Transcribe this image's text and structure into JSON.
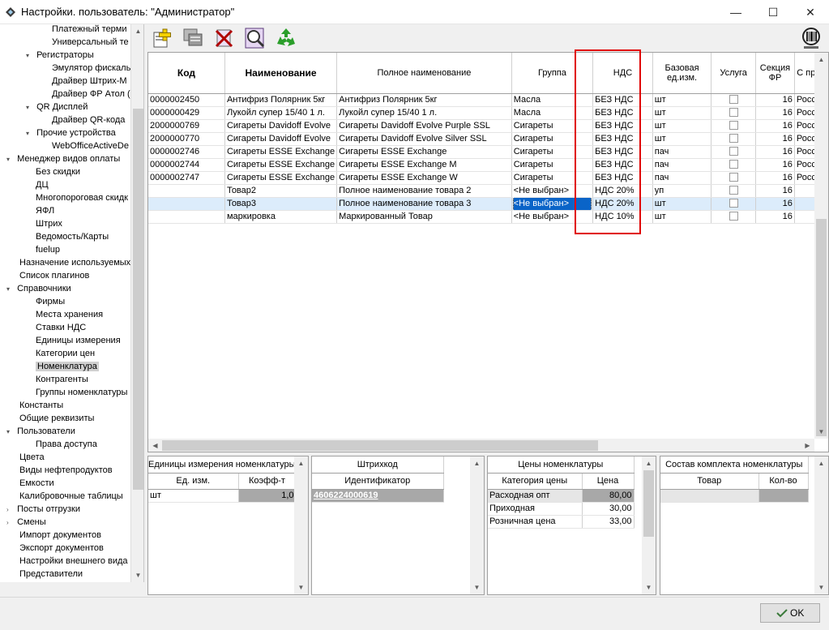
{
  "window": {
    "title": "Настройки. пользователь: \"Администратор\"",
    "minimize": "—",
    "maximize": "☐",
    "close": "✕"
  },
  "tree": {
    "items": [
      {
        "label": "Платежный терми",
        "level": 3,
        "expander": ""
      },
      {
        "label": "Универсальный те",
        "level": 3,
        "expander": ""
      },
      {
        "label": "Регистраторы",
        "level": 2,
        "expander": "▾"
      },
      {
        "label": "Эмулятор фискаль",
        "level": 3,
        "expander": ""
      },
      {
        "label": "Драйвер Штрих-М",
        "level": 3,
        "expander": ""
      },
      {
        "label": "Драйвер ФР Атол (",
        "level": 3,
        "expander": ""
      },
      {
        "label": "QR Дисплей",
        "level": 2,
        "expander": "▾"
      },
      {
        "label": "Драйвер QR-кода",
        "level": 3,
        "expander": ""
      },
      {
        "label": "Прочие устройства",
        "level": 2,
        "expander": "▾"
      },
      {
        "label": "WebOfficeActiveDe",
        "level": 3,
        "expander": ""
      },
      {
        "label": "Менеджер видов оплаты",
        "level": 0,
        "expander": "▾"
      },
      {
        "label": "Без скидки",
        "level": 1,
        "expander": ""
      },
      {
        "label": "ДЦ",
        "level": 1,
        "expander": ""
      },
      {
        "label": "Многопороговая скидк",
        "level": 1,
        "expander": ""
      },
      {
        "label": "ЯФЛ",
        "level": 1,
        "expander": ""
      },
      {
        "label": "Штрих",
        "level": 1,
        "expander": ""
      },
      {
        "label": "Ведомость/Карты",
        "level": 1,
        "expander": ""
      },
      {
        "label": "fuelup",
        "level": 1,
        "expander": ""
      },
      {
        "label": "Назначение используемых",
        "level": 0,
        "expander": ""
      },
      {
        "label": "Список плагинов",
        "level": 0,
        "expander": ""
      },
      {
        "label": "Справочники",
        "level": 0,
        "expander": "▾"
      },
      {
        "label": "Фирмы",
        "level": 1,
        "expander": ""
      },
      {
        "label": "Места хранения",
        "level": 1,
        "expander": ""
      },
      {
        "label": "Ставки НДС",
        "level": 1,
        "expander": ""
      },
      {
        "label": "Единицы измерения",
        "level": 1,
        "expander": ""
      },
      {
        "label": "Категории цен",
        "level": 1,
        "expander": ""
      },
      {
        "label": "Номенклатура",
        "level": 1,
        "expander": "",
        "selected": true
      },
      {
        "label": "Контрагенты",
        "level": 1,
        "expander": ""
      },
      {
        "label": "Группы номенклатуры",
        "level": 1,
        "expander": ""
      },
      {
        "label": "Константы",
        "level": 0,
        "expander": ""
      },
      {
        "label": "Общие реквизиты",
        "level": 0,
        "expander": ""
      },
      {
        "label": "Пользователи",
        "level": 0,
        "expander": "▾"
      },
      {
        "label": "Права доступа",
        "level": 1,
        "expander": ""
      },
      {
        "label": "Цвета",
        "level": 0,
        "expander": ""
      },
      {
        "label": "Виды нефтепродуктов",
        "level": 0,
        "expander": ""
      },
      {
        "label": "Емкости",
        "level": 0,
        "expander": ""
      },
      {
        "label": "Калибровочные таблицы",
        "level": 0,
        "expander": ""
      },
      {
        "label": "Посты отгрузки",
        "level": 0,
        "expander": "›"
      },
      {
        "label": "Смены",
        "level": 0,
        "expander": "›"
      },
      {
        "label": "Импорт документов",
        "level": 0,
        "expander": ""
      },
      {
        "label": "Экспорт документов",
        "level": 0,
        "expander": ""
      },
      {
        "label": "Настройки внешнего вида",
        "level": 0,
        "expander": ""
      },
      {
        "label": "Представители",
        "level": 0,
        "expander": ""
      }
    ]
  },
  "toolbar": {
    "buttons": [
      "add-icon",
      "copy-icon",
      "delete-icon",
      "find-icon",
      "refresh-icon",
      "barcode-icon"
    ]
  },
  "grid": {
    "columns": [
      "Код",
      "Наименование",
      "Полное наименование",
      "Группа",
      "НДС",
      "Базовая ед.изм.",
      "Услуга",
      "Секция ФР",
      "Страна происхождения"
    ],
    "column_visible_labels": [
      "Код",
      "Наименование",
      "Полное наименование",
      "Группа",
      "НДС",
      "Базовая ед.изм.",
      "Услуга",
      "Секция ФР",
      "С прои"
    ],
    "rows": [
      {
        "code": "0000002450",
        "name": "Антифриз Полярник 5кг",
        "full": "Антифриз Полярник 5кг",
        "group": "Масла",
        "vat": "БЕЗ НДС",
        "unit": "шт",
        "service": false,
        "section": "16",
        "country": "Россия"
      },
      {
        "code": "0000000429",
        "name": "Лукойл супер 15/40 1 л.",
        "full": "Лукойл супер 15/40 1 л.",
        "group": "Масла",
        "vat": "БЕЗ НДС",
        "unit": "шт",
        "service": false,
        "section": "16",
        "country": "Россия"
      },
      {
        "code": "2000000769",
        "name": "Сигареты Davidoff Evolve",
        "full": "Сигареты Davidoff Evolve Purple SSL",
        "group": "Сигареты",
        "vat": "БЕЗ НДС",
        "unit": "шт",
        "service": false,
        "section": "16",
        "country": "Россия"
      },
      {
        "code": "2000000770",
        "name": "Сигареты Davidoff Evolve",
        "full": "Сигареты Davidoff Evolve Silver SSL",
        "group": "Сигареты",
        "vat": "БЕЗ НДС",
        "unit": "шт",
        "service": false,
        "section": "16",
        "country": "Россия"
      },
      {
        "code": "0000002746",
        "name": "Сигареты ESSE Exchange",
        "full": "Сигареты ESSE Exchange",
        "group": "Сигареты",
        "vat": "БЕЗ НДС",
        "unit": "пач",
        "service": false,
        "section": "16",
        "country": "Россия"
      },
      {
        "code": "0000002744",
        "name": "Сигареты ESSE Exchange",
        "full": "Сигареты ESSE Exchange M",
        "group": "Сигареты",
        "vat": "БЕЗ НДС",
        "unit": "пач",
        "service": false,
        "section": "16",
        "country": "Россия"
      },
      {
        "code": "0000002747",
        "name": "Сигареты ESSE Exchange",
        "full": "Сигареты ESSE Exchange W",
        "group": "Сигареты",
        "vat": "БЕЗ НДС",
        "unit": "пач",
        "service": false,
        "section": "16",
        "country": "Россия"
      },
      {
        "code": "",
        "name": "Товар2",
        "full": "Полное наименование товара 2",
        "group": "<Не выбран>",
        "vat": "НДС 20%",
        "unit": "уп",
        "service": false,
        "section": "16",
        "country": ""
      },
      {
        "code": "",
        "name": "Товар3",
        "full": "Полное наименование товара 3",
        "group": "<Не выбран>",
        "vat": "НДС 20%",
        "unit": "шт",
        "service": false,
        "section": "16",
        "country": "",
        "selected": true
      },
      {
        "code": "",
        "name": "маркировка",
        "full": "Маркированный Товар",
        "group": "<Не выбран>",
        "vat": "НДС 10%",
        "unit": "шт",
        "service": false,
        "section": "16",
        "country": ""
      }
    ]
  },
  "units_panel": {
    "title": "Единицы измерения номенклатуры",
    "col_unit": "Ед. изм.",
    "col_coef": "Коэфф-т",
    "rows": [
      {
        "unit": "шт",
        "coef": "1,0"
      }
    ]
  },
  "barcode_panel": {
    "title": "Штрихкод",
    "col_id": "Идентификатор",
    "rows": [
      {
        "id": "4606224000619"
      }
    ]
  },
  "prices_panel": {
    "title": "Цены номенклатуры",
    "col_cat": "Категория цены",
    "col_price": "Цена",
    "rows": [
      {
        "cat": "Расходная опт",
        "price": "80,00"
      },
      {
        "cat": "Приходная",
        "price": "30,00"
      },
      {
        "cat": "Розничная цена",
        "price": "33,00"
      }
    ]
  },
  "kit_panel": {
    "title": "Состав комплекта номенклатуры",
    "col_item": "Товар",
    "col_qty": "Кол-во"
  },
  "footer": {
    "ok_label": "OK"
  },
  "colors": {
    "highlight": "#e00000",
    "selection": "#0a64c8",
    "row_selected": "#dcecfb"
  }
}
